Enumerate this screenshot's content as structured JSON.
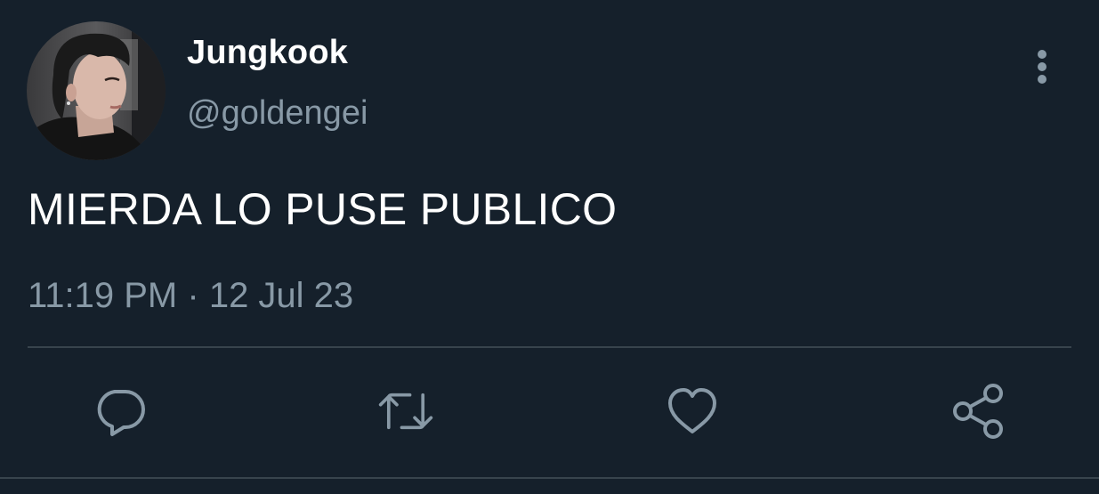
{
  "tweet": {
    "author": {
      "display_name": "Jungkook",
      "handle": "@goldengei",
      "avatar_icon": "profile-photo"
    },
    "text": "MIERDA LO PUSE PUBLICO",
    "time": "11:19 PM",
    "separator": "·",
    "date": "12 Jul 23",
    "more_icon": "more-vertical-icon"
  },
  "actions": [
    {
      "name": "reply",
      "icon": "speech-bubble-icon"
    },
    {
      "name": "retweet",
      "icon": "retweet-arrows-icon"
    },
    {
      "name": "like",
      "icon": "heart-icon"
    },
    {
      "name": "share",
      "icon": "share-nodes-icon"
    }
  ],
  "colors": {
    "background": "#15202b",
    "primary_text": "#ffffff",
    "secondary_text": "#8899a6",
    "divider": "#38444d"
  }
}
